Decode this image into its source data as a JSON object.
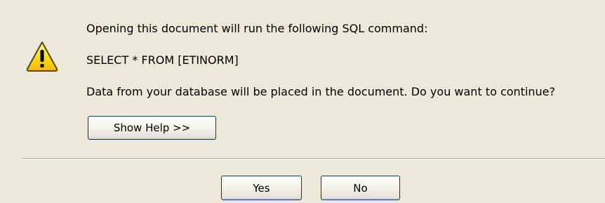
{
  "dialog": {
    "icon": "warning-icon",
    "message_line1": "Opening this document will run the following SQL command:",
    "sql_command": "SELECT * FROM [ETINORM]",
    "message_line3": "Data from your database will be placed in the document. Do you want to continue?",
    "help_button": "Show Help >>",
    "yes_button": "Yes",
    "no_button": "No"
  },
  "colors": {
    "background": "#ece9d8",
    "button_border": "#003c74",
    "warning_fill": "#ffd800",
    "warning_outline": "#5a4a00"
  }
}
